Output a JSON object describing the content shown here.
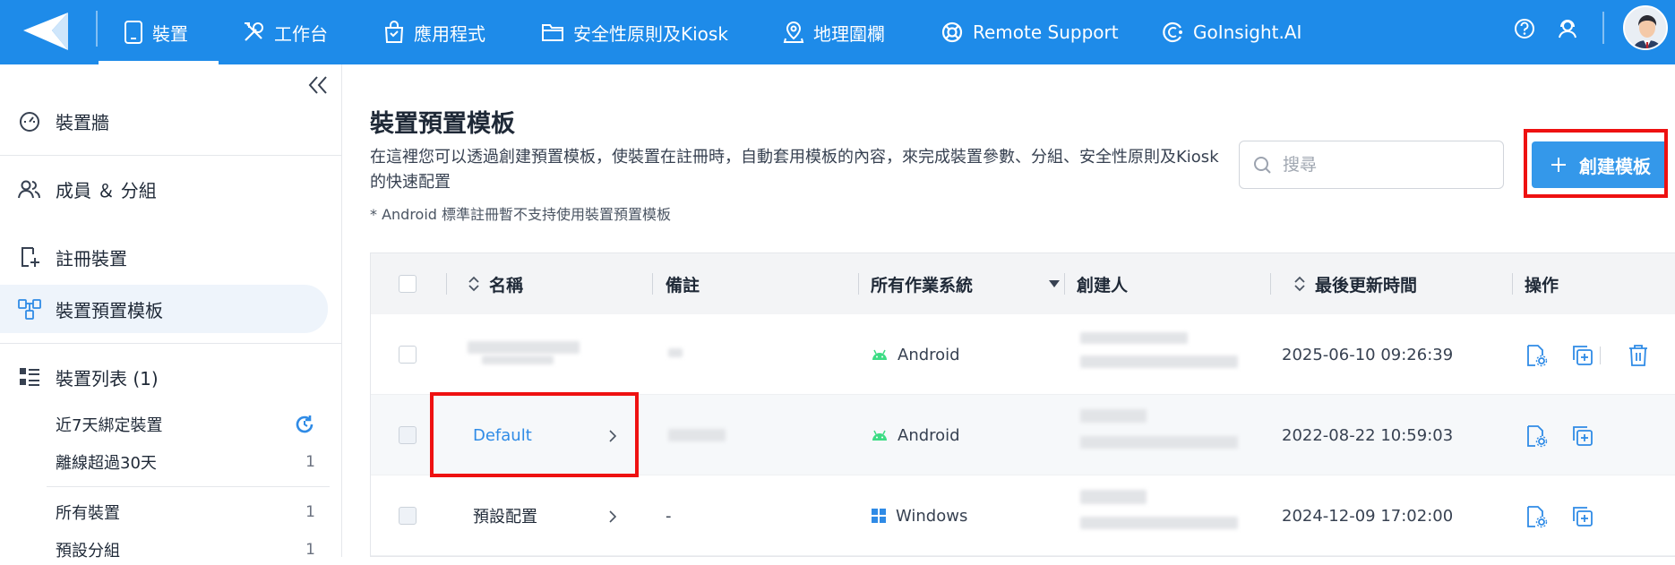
{
  "nav": {
    "items": [
      {
        "label": "裝置",
        "icon": "device-icon"
      },
      {
        "label": "工作台",
        "icon": "tools-icon"
      },
      {
        "label": "應用程式",
        "icon": "app-bag-icon"
      },
      {
        "label": "安全性原則及Kiosk",
        "icon": "folder-icon"
      },
      {
        "label": "地理圍欄",
        "icon": "map-pin-icon"
      },
      {
        "label": "Remote Support",
        "icon": "lifebuoy-icon"
      },
      {
        "label": "GoInsight.AI",
        "icon": "ai-icon"
      }
    ]
  },
  "sidebar": {
    "items": [
      {
        "label": "裝置牆",
        "icon": "dashboard-icon"
      },
      {
        "label": "成員 ＆ 分組",
        "icon": "users-icon"
      },
      {
        "label": "註冊裝置",
        "icon": "register-device-icon"
      },
      {
        "label": "裝置預置模板",
        "icon": "template-icon"
      },
      {
        "label": "裝置列表 (1)",
        "icon": "list-icon"
      }
    ],
    "sub_items": [
      {
        "label": "近7天綁定裝置",
        "count": ""
      },
      {
        "label": "離線超過30天",
        "count": "1"
      },
      {
        "label": "所有裝置",
        "count": "1"
      },
      {
        "label": "預設分組",
        "count": "1"
      }
    ]
  },
  "page": {
    "title": "裝置預置模板",
    "description": "在這裡您可以透過創建預置模板，使裝置在註冊時，自動套用模板的內容，來完成裝置參數、分組、安全性原則及Kiosk的快速配置",
    "note": "* Android 標準註冊暫不支持使用裝置預置模板",
    "search_placeholder": "搜尋",
    "create_button": "創建模板"
  },
  "table": {
    "headers": {
      "name": "名稱",
      "remark": "備註",
      "os_filter": "所有作業系統",
      "creator": "創建人",
      "updated": "最後更新時間",
      "actions": "操作"
    },
    "rows": [
      {
        "name": "",
        "remark": "",
        "os": "Android",
        "updated": "2025-06-10 09:26:39"
      },
      {
        "name": "Default",
        "remark": "",
        "os": "Android",
        "updated": "2022-08-22 10:59:03"
      },
      {
        "name": "預設配置",
        "remark": "-",
        "os": "Windows",
        "updated": "2024-12-09 17:02:00"
      }
    ]
  },
  "colors": {
    "brand": "#1e8be9",
    "link": "#2f8be6",
    "android": "#3ddc84",
    "windows": "#2f8be6",
    "highlight": "#ee1111"
  }
}
